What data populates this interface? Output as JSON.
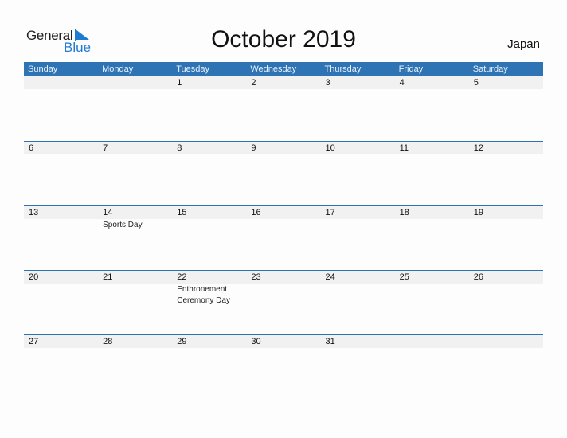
{
  "logo": {
    "line1": "General",
    "line2": "Blue",
    "accent_color": "#1f7bd1"
  },
  "title": "October 2019",
  "country": "Japan",
  "header_color": "#2e74b5",
  "weekdays": [
    "Sunday",
    "Monday",
    "Tuesday",
    "Wednesday",
    "Thursday",
    "Friday",
    "Saturday"
  ],
  "weeks": [
    {
      "dates": [
        "",
        "",
        "1",
        "2",
        "3",
        "4",
        "5"
      ],
      "events": [
        "",
        "",
        "",
        "",
        "",
        "",
        ""
      ]
    },
    {
      "dates": [
        "6",
        "7",
        "8",
        "9",
        "10",
        "11",
        "12"
      ],
      "events": [
        "",
        "",
        "",
        "",
        "",
        "",
        ""
      ]
    },
    {
      "dates": [
        "13",
        "14",
        "15",
        "16",
        "17",
        "18",
        "19"
      ],
      "events": [
        "",
        "Sports Day",
        "",
        "",
        "",
        "",
        ""
      ]
    },
    {
      "dates": [
        "20",
        "21",
        "22",
        "23",
        "24",
        "25",
        "26"
      ],
      "events": [
        "",
        "",
        "Enthronement Ceremony Day",
        "",
        "",
        "",
        ""
      ]
    },
    {
      "dates": [
        "27",
        "28",
        "29",
        "30",
        "31",
        "",
        ""
      ],
      "events": [
        "",
        "",
        "",
        "",
        "",
        "",
        ""
      ]
    }
  ]
}
